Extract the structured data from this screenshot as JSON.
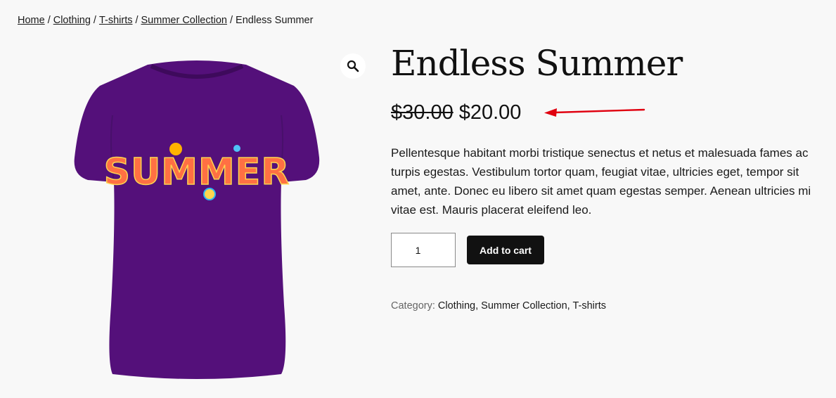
{
  "breadcrumb": {
    "home": "Home",
    "clothing": "Clothing",
    "tshirts": "T-shirts",
    "summer_collection": "Summer Collection",
    "current": "Endless Summer",
    "separator": "/"
  },
  "product": {
    "title": "Endless Summer",
    "price_old": "$30.00",
    "price_new": "$20.00",
    "description": "Pellentesque habitant morbi tristique senectus et netus et malesuada fames ac turpis egestas. Vestibulum tortor quam, feugiat vitae, ultricies eget, tempor sit amet, ante. Donec eu libero sit amet quam egestas semper. Aenean ultricies mi vitae est. Mauris placerat eleifend leo.",
    "quantity": "1",
    "add_to_cart_label": "Add to cart",
    "shirt_print_text": "SUMMER"
  },
  "meta": {
    "category_label": "Category:",
    "categories": [
      "Clothing",
      "Summer Collection",
      "T-shirts"
    ],
    "category_separator": ","
  },
  "icons": {
    "zoom": "magnifier-icon",
    "annotation": "red-arrow-annotation"
  },
  "colors": {
    "background": "#f8f8f8",
    "shirt": "#54107a",
    "button": "#111111",
    "annotation_arrow": "#e0000f"
  }
}
